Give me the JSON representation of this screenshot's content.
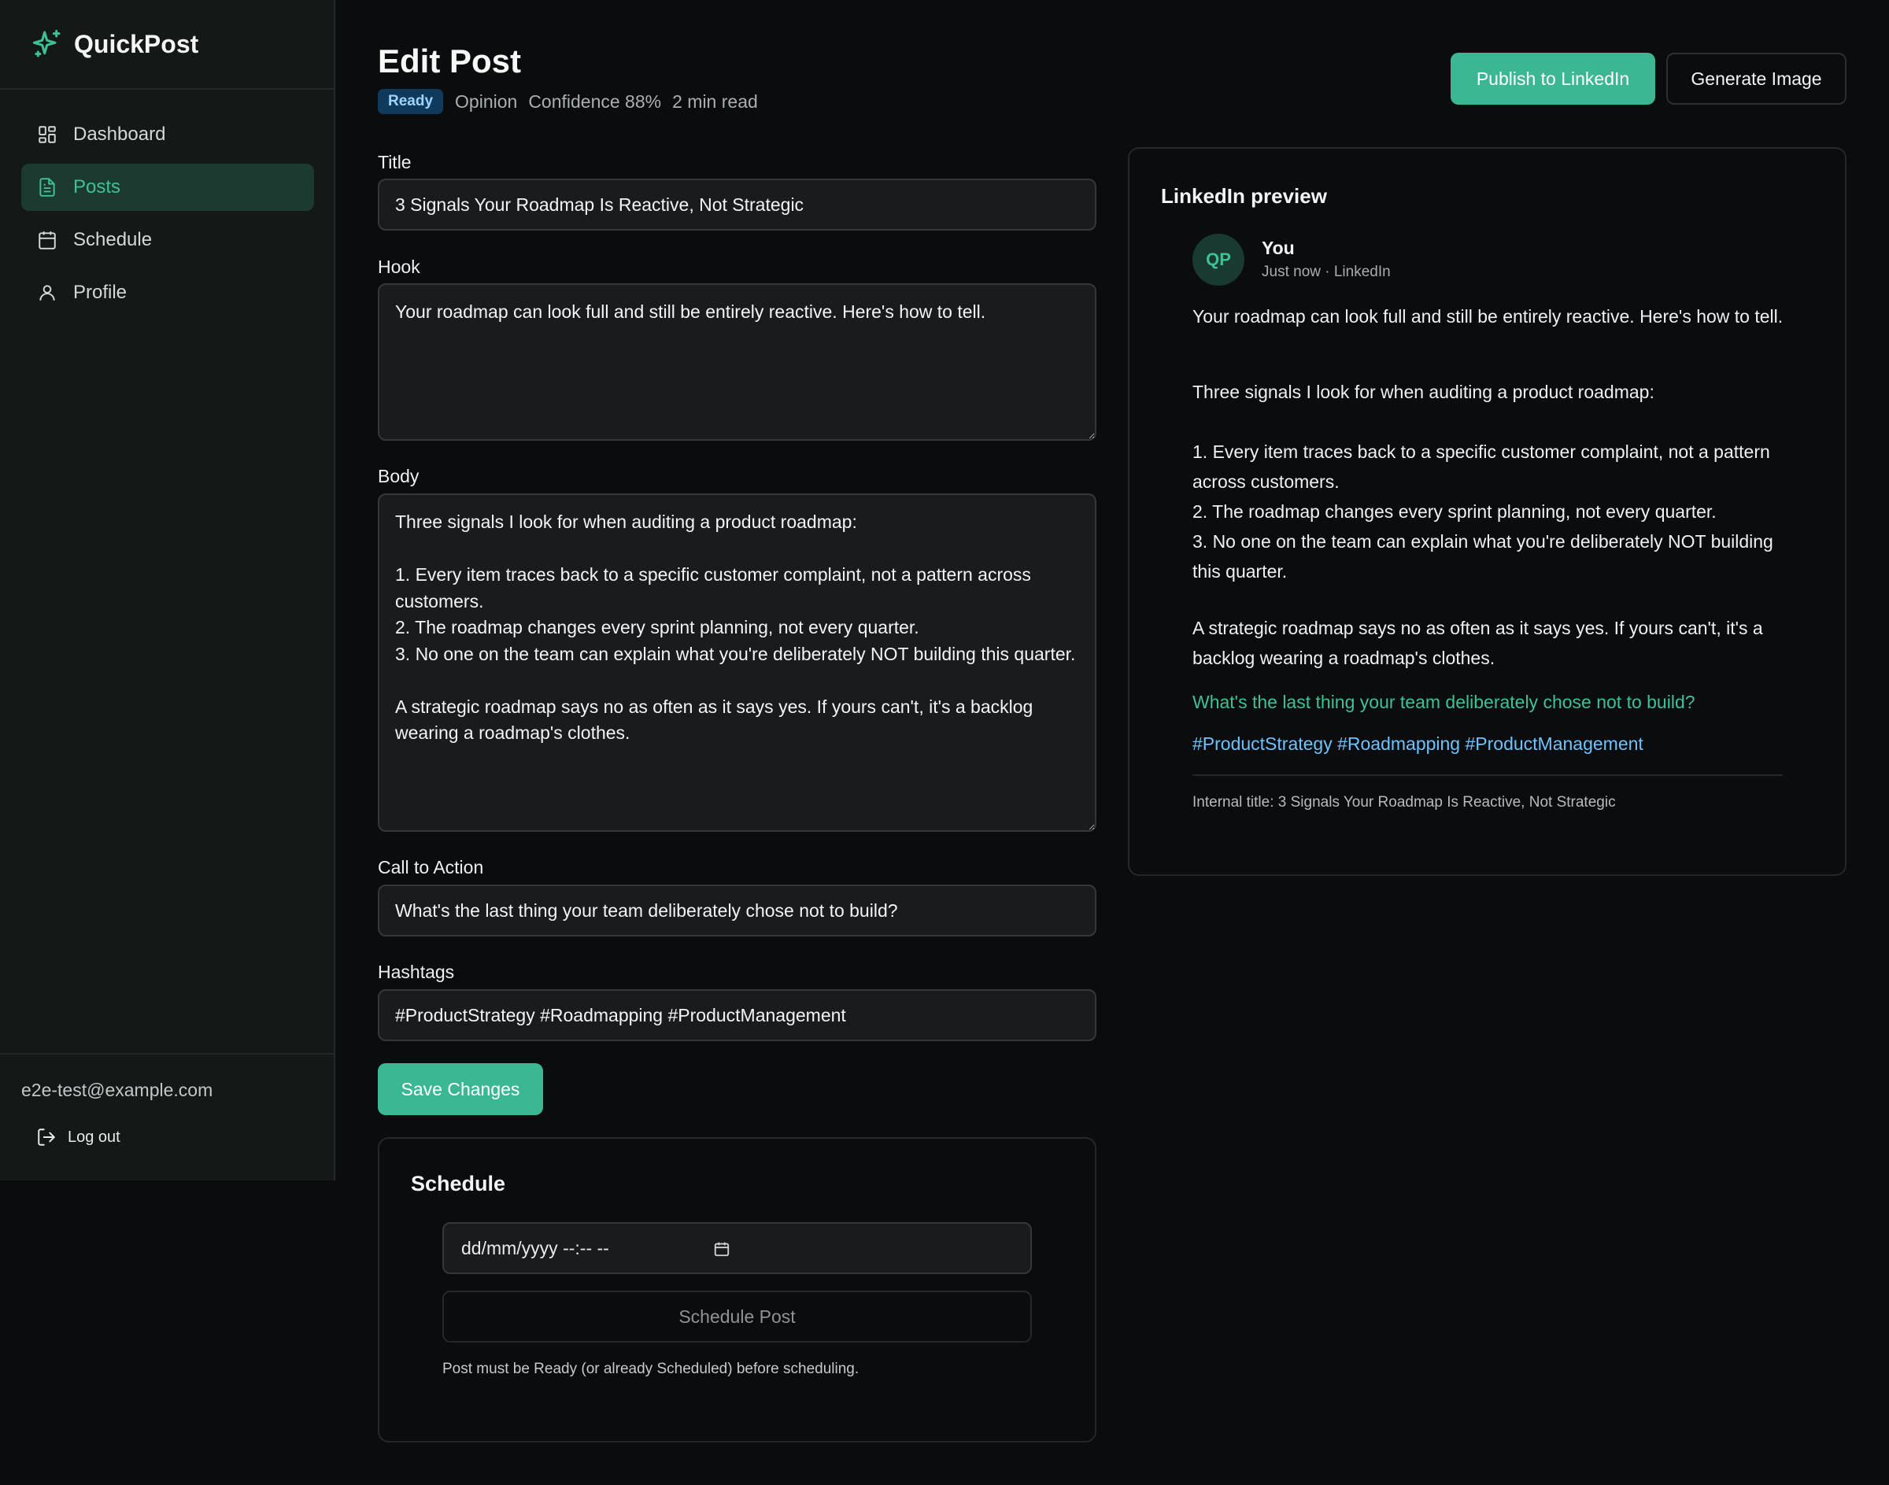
{
  "brand": {
    "name": "QuickPost"
  },
  "sidebar": {
    "items": [
      {
        "label": "Dashboard",
        "icon": "dashboard-icon",
        "active": false
      },
      {
        "label": "Posts",
        "icon": "file-text-icon",
        "active": true
      },
      {
        "label": "Schedule",
        "icon": "calendar-icon",
        "active": false
      },
      {
        "label": "Profile",
        "icon": "user-icon",
        "active": false
      }
    ],
    "user_email": "e2e-test@example.com",
    "logout_label": "Log out"
  },
  "header": {
    "title": "Edit Post",
    "status_badge": "Ready",
    "category": "Opinion",
    "confidence": "Confidence 88%",
    "read_time": "2 min read",
    "publish_label": "Publish to LinkedIn",
    "generate_label": "Generate Image"
  },
  "form": {
    "title_label": "Title",
    "title_value": "3 Signals Your Roadmap Is Reactive, Not Strategic",
    "hook_label": "Hook",
    "hook_value": "Your roadmap can look full and still be entirely reactive. Here's how to tell.",
    "body_label": "Body",
    "body_value": "Three signals I look for when auditing a product roadmap:\n\n1. Every item traces back to a specific customer complaint, not a pattern across customers.\n2. The roadmap changes every sprint planning, not every quarter.\n3. No one on the team can explain what you're deliberately NOT building this quarter.\n\nA strategic roadmap says no as often as it says yes. If yours can't, it's a backlog wearing a roadmap's clothes.",
    "cta_label": "Call to Action",
    "cta_value": "What's the last thing your team deliberately chose not to build?",
    "hashtags_label": "Hashtags",
    "hashtags_value": "#ProductStrategy #Roadmapping #ProductManagement",
    "save_label": "Save Changes"
  },
  "schedule": {
    "title": "Schedule",
    "datetime_placeholder": "dd/mm/yyyy --:-- --",
    "button_label": "Schedule Post",
    "note": "Post must be Ready (or already Scheduled) before scheduling."
  },
  "preview": {
    "heading": "LinkedIn preview",
    "avatar_initials": "QP",
    "author": "You",
    "author_meta": "Just now · LinkedIn",
    "hook": "Your roadmap can look full and still be entirely reactive. Here's how to tell.",
    "body_intro": "Three signals I look for when auditing a product roadmap:",
    "body_list": "1. Every item traces back to a specific customer complaint, not a pattern across customers.\n2. The roadmap changes every sprint planning, not every quarter.\n3. No one on the team can explain what you're deliberately NOT building this quarter.",
    "body_outro": "A strategic roadmap says no as often as it says yes. If yours can't, it's a backlog wearing a roadmap's clothes.",
    "cta": "What's the last thing your team deliberately chose not to build?",
    "hashtags": "#ProductStrategy #Roadmapping #ProductManagement",
    "internal_title": "Internal title: 3 Signals Your Roadmap Is Reactive, Not Strategic"
  },
  "colors": {
    "accent": "#3bb893",
    "background": "#0b0c0d",
    "sidebar": "#141816",
    "badge": "#0f3a5c",
    "hashtag": "#6cc3ff"
  }
}
